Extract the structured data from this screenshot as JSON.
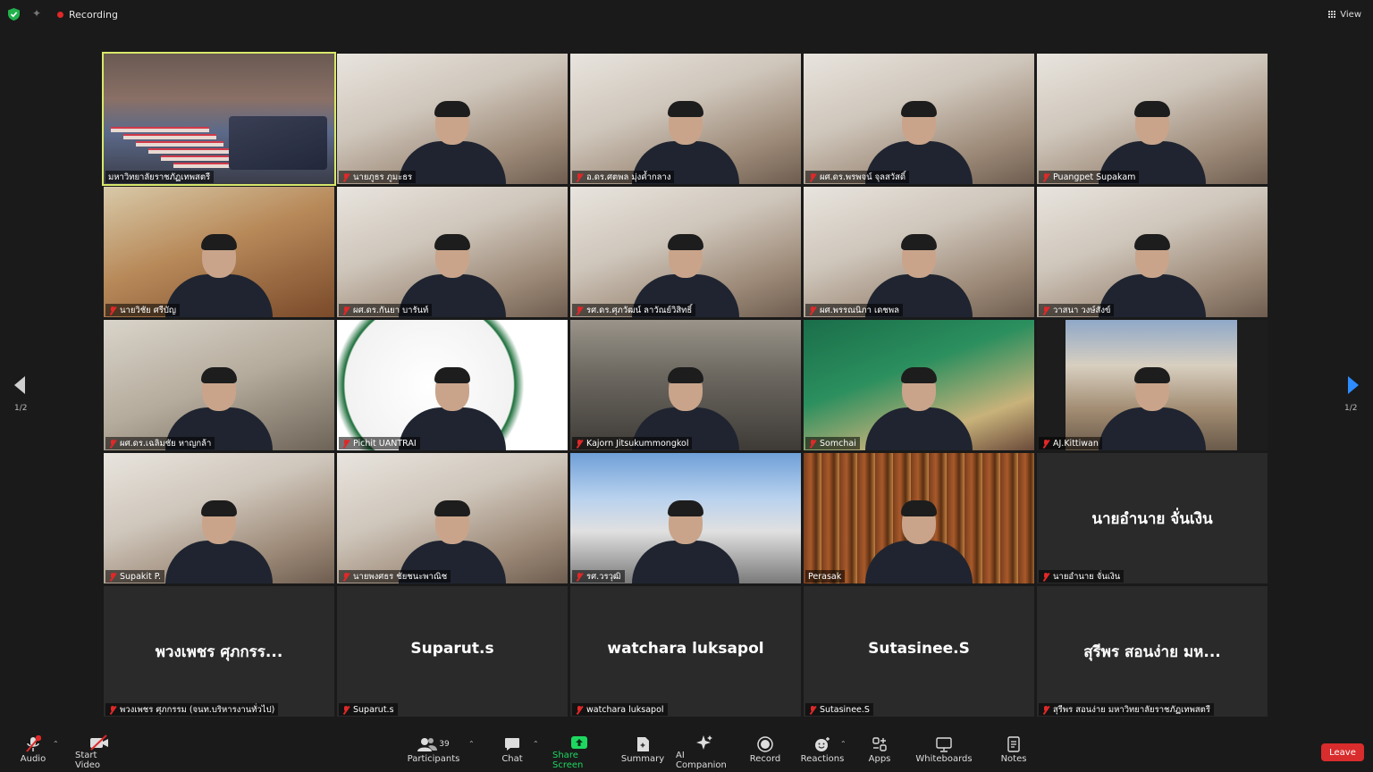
{
  "topbar": {
    "recording_label": "Recording",
    "view_label": "View"
  },
  "navigation": {
    "page_indicator_left": "1/2",
    "page_indicator_right": "1/2"
  },
  "participants": [
    {
      "name": "มหาวิทยาลัยราชภัฏเทพสตรี",
      "muted": false,
      "video": true,
      "scene": "room",
      "active": true
    },
    {
      "name": "นายภูธร ภูมะธร",
      "muted": true,
      "video": true,
      "scene": "office"
    },
    {
      "name": "อ.ดร.ศตพล มุ่งค้ำกลาง",
      "muted": true,
      "video": true,
      "scene": "office"
    },
    {
      "name": "ผศ.ดร.พรพจน์ จุลสวัสดิ์",
      "muted": true,
      "video": true,
      "scene": "office"
    },
    {
      "name": "Puangpet Supakam",
      "muted": true,
      "video": true,
      "scene": "office"
    },
    {
      "name": "นายวิชัย ศรีบัญ",
      "muted": true,
      "video": true,
      "scene": "logo-wall"
    },
    {
      "name": "ผศ.ดร.กันยา บารันท์",
      "muted": true,
      "video": true,
      "scene": "office"
    },
    {
      "name": "รศ.ดร.ศุภวัฒน์ ลาวัณย์วิสิทธิ์",
      "muted": true,
      "video": true,
      "scene": "office"
    },
    {
      "name": "ผศ.พรรณนิภา เดชพล",
      "muted": true,
      "video": true,
      "scene": "office"
    },
    {
      "name": "วาสนา วงษ์สังข์",
      "muted": true,
      "video": true,
      "scene": "office"
    },
    {
      "name": "ผศ.ดร.เฉลิมชัย หาญกล้า",
      "muted": true,
      "video": true,
      "scene": "shelf"
    },
    {
      "name": "Pichit UANTRAI",
      "muted": true,
      "video": true,
      "scene": "logo"
    },
    {
      "name": "Kajorn Jitsukummongkol",
      "muted": true,
      "video": true,
      "scene": "hall"
    },
    {
      "name": "Somchai",
      "muted": true,
      "video": true,
      "scene": "banner"
    },
    {
      "name": "AJ.Kittiwan",
      "muted": true,
      "video": true,
      "scene": "building"
    },
    {
      "name": "Supakit P.",
      "muted": true,
      "video": true,
      "scene": "office"
    },
    {
      "name": "นายพงศธร ชัยชนะพาณิช",
      "muted": true,
      "video": true,
      "scene": "office"
    },
    {
      "name": "รศ.วรวุฒิ",
      "muted": true,
      "video": true,
      "scene": "temple"
    },
    {
      "name": "Perasak",
      "muted": false,
      "video": true,
      "scene": "library"
    },
    {
      "name": "นายอำนาย จั่นเงิน",
      "muted": true,
      "video": false,
      "display": "นายอำนาย จั่นเงิน"
    },
    {
      "name": "พวงเพชร ศุภกรรม (จนท.บริหารงานทั่วไป)",
      "muted": true,
      "video": false,
      "display": "พวงเพชร ศุภกรร..."
    },
    {
      "name": "Suparut.s",
      "muted": true,
      "video": false,
      "display": "Suparut.s"
    },
    {
      "name": "watchara luksapol",
      "muted": true,
      "video": false,
      "display": "watchara luksapol"
    },
    {
      "name": "Sutasinee.S",
      "muted": true,
      "video": false,
      "display": "Sutasinee.S"
    },
    {
      "name": "สุรีพร สอนง่าย มหาวิทยาลัยราชภัฏเทพสตรี",
      "muted": true,
      "video": false,
      "display": "สุรีพร สอนง่าย มห..."
    }
  ],
  "toolbar": {
    "audio": "Audio",
    "start_video": "Start Video",
    "participants": "Participants",
    "participants_count": "39",
    "chat": "Chat",
    "share_screen": "Share Screen",
    "summary": "Summary",
    "ai_companion": "AI Companion",
    "record": "Record",
    "reactions": "Reactions",
    "apps": "Apps",
    "whiteboards": "Whiteboards",
    "notes": "Notes",
    "leave": "Leave"
  },
  "colors": {
    "active_speaker_border": "#d8e86a",
    "share_green": "#1ed760",
    "leave_red": "#d92c2c",
    "recording_red": "#e02828"
  }
}
